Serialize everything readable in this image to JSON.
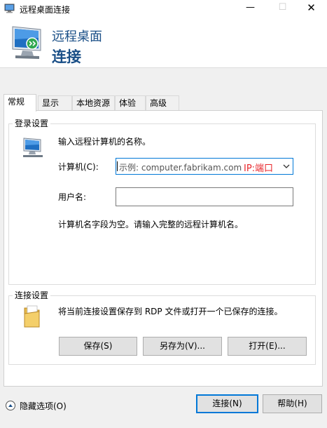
{
  "window": {
    "title": "远程桌面连接",
    "minimize": "—",
    "maximize": "☐",
    "close": "✕"
  },
  "banner": {
    "line1": "远程桌面",
    "line2": "连接"
  },
  "tabs": [
    {
      "label": "常规",
      "active": true
    },
    {
      "label": "显示",
      "active": false
    },
    {
      "label": "本地资源",
      "active": false
    },
    {
      "label": "体验",
      "active": false
    },
    {
      "label": "高级",
      "active": false
    }
  ],
  "login": {
    "group_label": "登录设置",
    "prompt": "输入远程计算机的名称。",
    "computer_label": "计算机(C):",
    "computer_placeholder": "示例: computer.fabrikam.com",
    "computer_annotation": "IP:端口",
    "username_label": "用户名:",
    "username_value": "",
    "message": "计算机名字段为空。请输入完整的远程计算机名。"
  },
  "connection": {
    "group_label": "连接设置",
    "description": "将当前连接设置保存到 RDP 文件或打开一个已保存的连接。",
    "save_button": "保存(S)",
    "save_as_button": "另存为(V)...",
    "open_button": "打开(E)..."
  },
  "footer": {
    "hide_options": "隐藏选项(O)",
    "connect_button": "连接(N)",
    "help_button": "帮助(H)"
  },
  "colors": {
    "accent": "#0078d7",
    "banner_text": "#1a4f87",
    "annotation": "#e8262b"
  }
}
